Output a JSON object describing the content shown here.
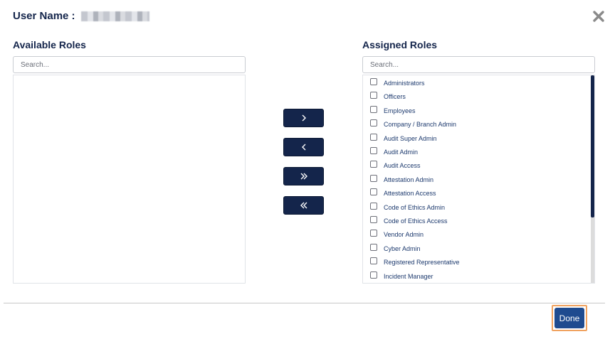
{
  "dialog": {
    "user_name_label": "User Name :",
    "close_icon": "close-icon"
  },
  "available": {
    "title": "Available Roles",
    "search_placeholder": "Search...",
    "items": []
  },
  "assigned": {
    "title": "Assigned Roles",
    "search_placeholder": "Search...",
    "items": [
      "Administrators",
      "Officers",
      "Employees",
      "Company / Branch Admin",
      "Audit Super Admin",
      "Audit Admin",
      "Audit Access",
      "Attestation Admin",
      "Attestation Access",
      "Code of Ethics Admin",
      "Code of Ethics Access",
      "Vendor Admin",
      "Cyber Admin",
      "Registered Representative",
      "Incident Manager"
    ]
  },
  "move_buttons": [
    {
      "icon": "chevron-right-icon"
    },
    {
      "icon": "chevron-left-icon"
    },
    {
      "icon": "double-chevron-right-icon"
    },
    {
      "icon": "double-chevron-left-icon"
    }
  ],
  "footer": {
    "done_label": "Done"
  },
  "colors": {
    "primary": "#14254b",
    "done_button": "#1f4b8f",
    "focus_outline": "#f0a25f"
  }
}
